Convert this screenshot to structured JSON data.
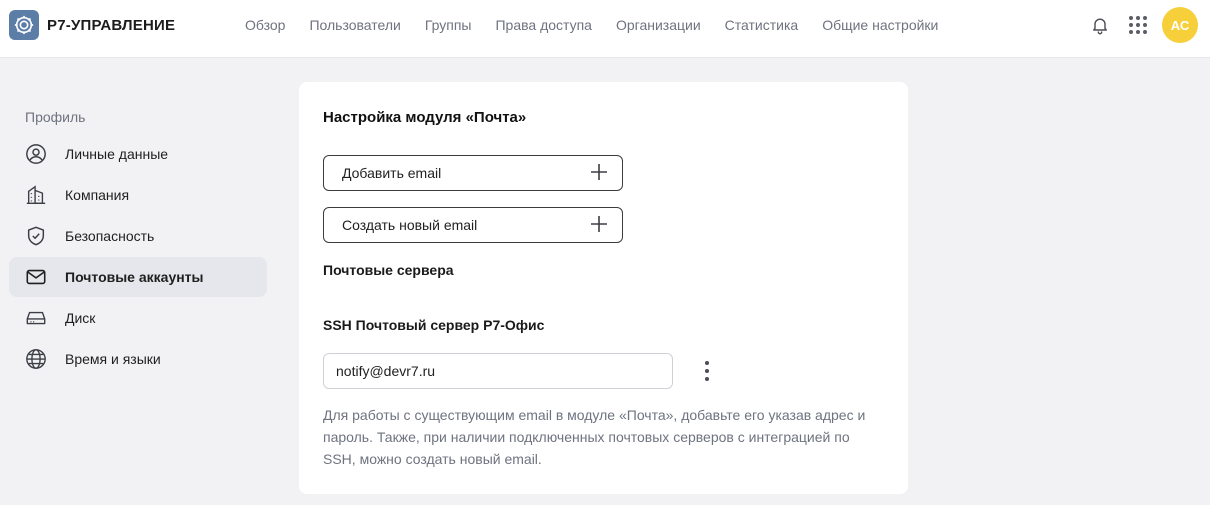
{
  "app": {
    "title": "Р7-УПРАВЛЕНИЕ",
    "accent": "#5b7da6"
  },
  "nav": {
    "items": [
      {
        "label": "Обзор"
      },
      {
        "label": "Пользователи"
      },
      {
        "label": "Группы"
      },
      {
        "label": "Права доступа"
      },
      {
        "label": "Организации"
      },
      {
        "label": "Статистика"
      },
      {
        "label": "Общие настройки"
      }
    ]
  },
  "user": {
    "initials": "АС",
    "avatar_color": "#f7cf3b"
  },
  "sidebar": {
    "title": "Профиль",
    "items": [
      {
        "label": "Личные данные",
        "icon": "user-circle-icon"
      },
      {
        "label": "Компания",
        "icon": "building-icon"
      },
      {
        "label": "Безопасность",
        "icon": "shield-check-icon"
      },
      {
        "label": "Почтовые аккаунты",
        "icon": "mail-icon",
        "active": true
      },
      {
        "label": "Диск",
        "icon": "drive-icon"
      },
      {
        "label": "Время и языки",
        "icon": "globe-icon"
      }
    ]
  },
  "mail": {
    "title": "Настройка модуля «Почта»",
    "add_email_label": "Добавить email",
    "create_email_label": "Создать новый email",
    "servers_title": "Почтовые сервера",
    "server_name": "SSH Почтовый сервер Р7-Офис",
    "server_email": "notify@devr7.ru",
    "hint": "Для работы с существующим email в модуле «Почта», добавьте его указав адрес и пароль. Также, при наличии подключенных почтовых серверов с интеграцией по SSH, можно создать новый email."
  }
}
